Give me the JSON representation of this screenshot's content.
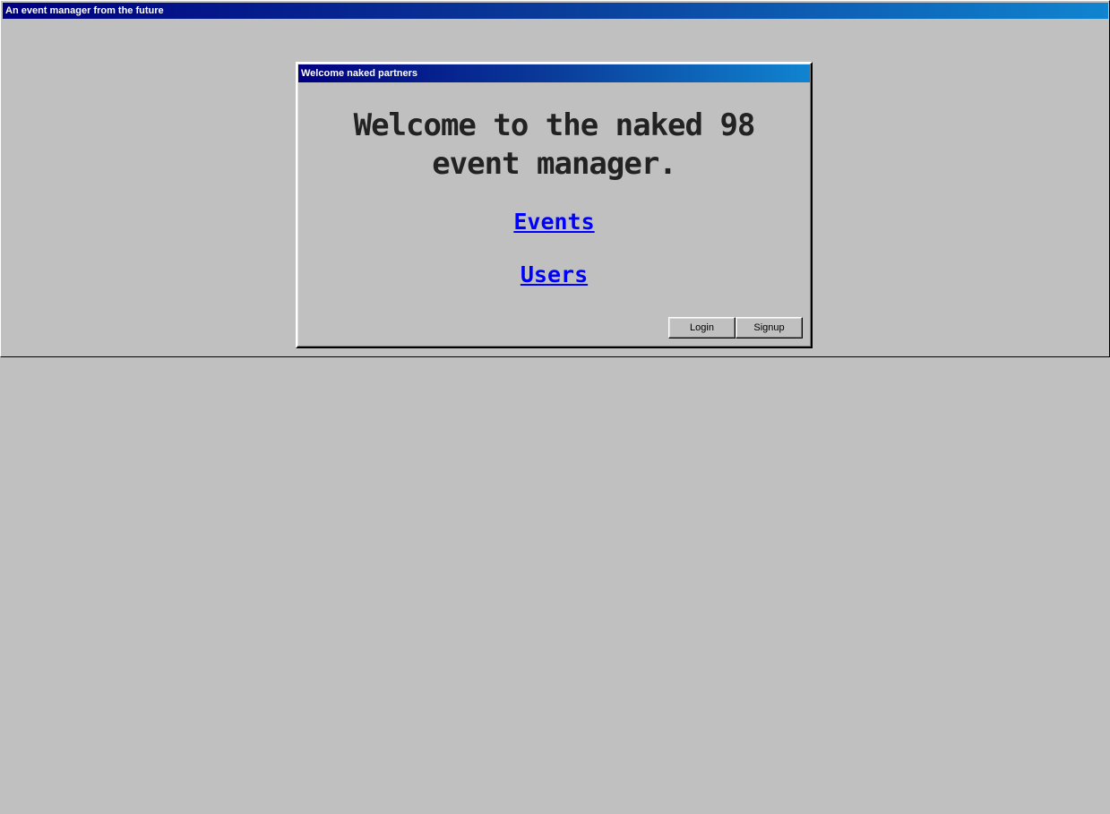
{
  "window": {
    "title": "An event manager from the future"
  },
  "dialog": {
    "title": "Welcome naked partners",
    "heading": "Welcome to the naked 98 event manager.",
    "links": {
      "events": "Events",
      "users": "Users"
    },
    "buttons": {
      "login": "Login",
      "signup": "Signup"
    }
  },
  "colors": {
    "background": "#c0c0c0",
    "titlebar_start": "#000080",
    "titlebar_end": "#1084d0",
    "link": "#0000ff",
    "heading_text": "#222222"
  }
}
